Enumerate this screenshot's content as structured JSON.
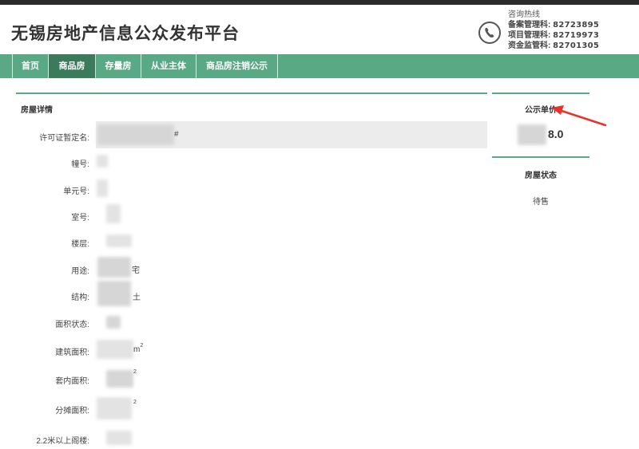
{
  "header": {
    "site_title": "无锡房地产信息公众发布平台",
    "hotline_title": "咨询热线",
    "hotlines": [
      {
        "label": "备案管理科:",
        "number": "82723895"
      },
      {
        "label": "项目管理科:",
        "number": "82719973"
      },
      {
        "label": "资金监管科:",
        "number": "82701305"
      }
    ]
  },
  "nav": {
    "items": [
      "首页",
      "商品房",
      "存量房",
      "从业主体",
      "商品房注销公示"
    ],
    "active_index": 1
  },
  "details": {
    "title": "房屋详情",
    "fields": [
      {
        "label": "许可证暂定名:",
        "visible_text": "#"
      },
      {
        "label": "幢号:",
        "visible_text": ""
      },
      {
        "label": "单元号:",
        "visible_text": ""
      },
      {
        "label": "室号:",
        "visible_text": ""
      },
      {
        "label": "楼层:",
        "visible_text": ""
      },
      {
        "label": "用途:",
        "visible_text": "宅"
      },
      {
        "label": "结构:",
        "visible_text": "土"
      },
      {
        "label": "面积状态:",
        "visible_text": ""
      },
      {
        "label": "建筑面积:",
        "visible_text": "m",
        "sup": "2"
      },
      {
        "label": "套内面积:",
        "visible_text": "",
        "sup": "2"
      },
      {
        "label": "分摊面积:",
        "visible_text": "",
        "sup": "2"
      },
      {
        "label": "2.2米以上阁楼:",
        "visible_text": ""
      }
    ]
  },
  "sidebar": {
    "unit_price_title": "公示单价",
    "unit_price_visible": "8.0",
    "status_title": "房屋状态",
    "status_value": "待售"
  },
  "colors": {
    "nav_bg": "#5aa985",
    "nav_active": "#3b7b5c",
    "annotation_arrow": "#e8332a"
  }
}
